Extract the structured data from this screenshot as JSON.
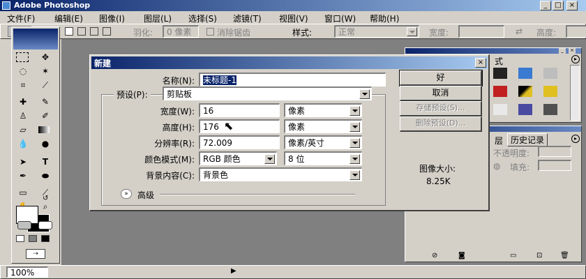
{
  "app": {
    "title": "Adobe Photoshop"
  },
  "menu": [
    "文件(F)",
    "编辑(E)",
    "图像(I)",
    "图层(L)",
    "选择(S)",
    "滤镜(T)",
    "视图(V)",
    "窗口(W)",
    "帮助(H)"
  ],
  "options_bar": {
    "feather_label": "羽化:",
    "feather_value": "0 像素",
    "antialias_label": "消除锯齿",
    "style_label": "样式:",
    "style_value": "正常",
    "width_label": "宽度:",
    "height_label": "高度:"
  },
  "dialog": {
    "title": "新建",
    "name_label": "名称(N):",
    "name_value": "未标题-1",
    "preset_group_label": "预设(P):",
    "preset_value": "剪贴板",
    "width_label": "宽度(W):",
    "width_value": "16",
    "width_unit": "像素",
    "height_label": "高度(H):",
    "height_value": "176",
    "height_unit": "像素",
    "resolution_label": "分辨率(R):",
    "resolution_value": "72.009",
    "resolution_unit": "像素/英寸",
    "color_mode_label": "颜色模式(M):",
    "color_mode_value": "RGB 颜色",
    "bit_depth_value": "8 位",
    "background_label": "背景内容(C):",
    "background_value": "背景色",
    "advanced_label": "高级",
    "ok_button": "好",
    "cancel_button": "取消",
    "save_preset_button": "存储预设(S)...",
    "delete_preset_button": "删除预设(D)...",
    "image_size_label": "图像大小:",
    "image_size_value": "8.25K"
  },
  "panels": {
    "styles_tab_fragment": "式",
    "layers_tab_fragment": "层",
    "history_tab": "历史记录",
    "opacity_label": "不透明度:",
    "fill_label": "填充:"
  },
  "status": {
    "zoom": "100%"
  },
  "colors": {
    "title_gradient_start": "#0a246a",
    "title_gradient_end": "#a6caf0",
    "workspace": "#808080",
    "chrome": "#d4d0c8"
  }
}
